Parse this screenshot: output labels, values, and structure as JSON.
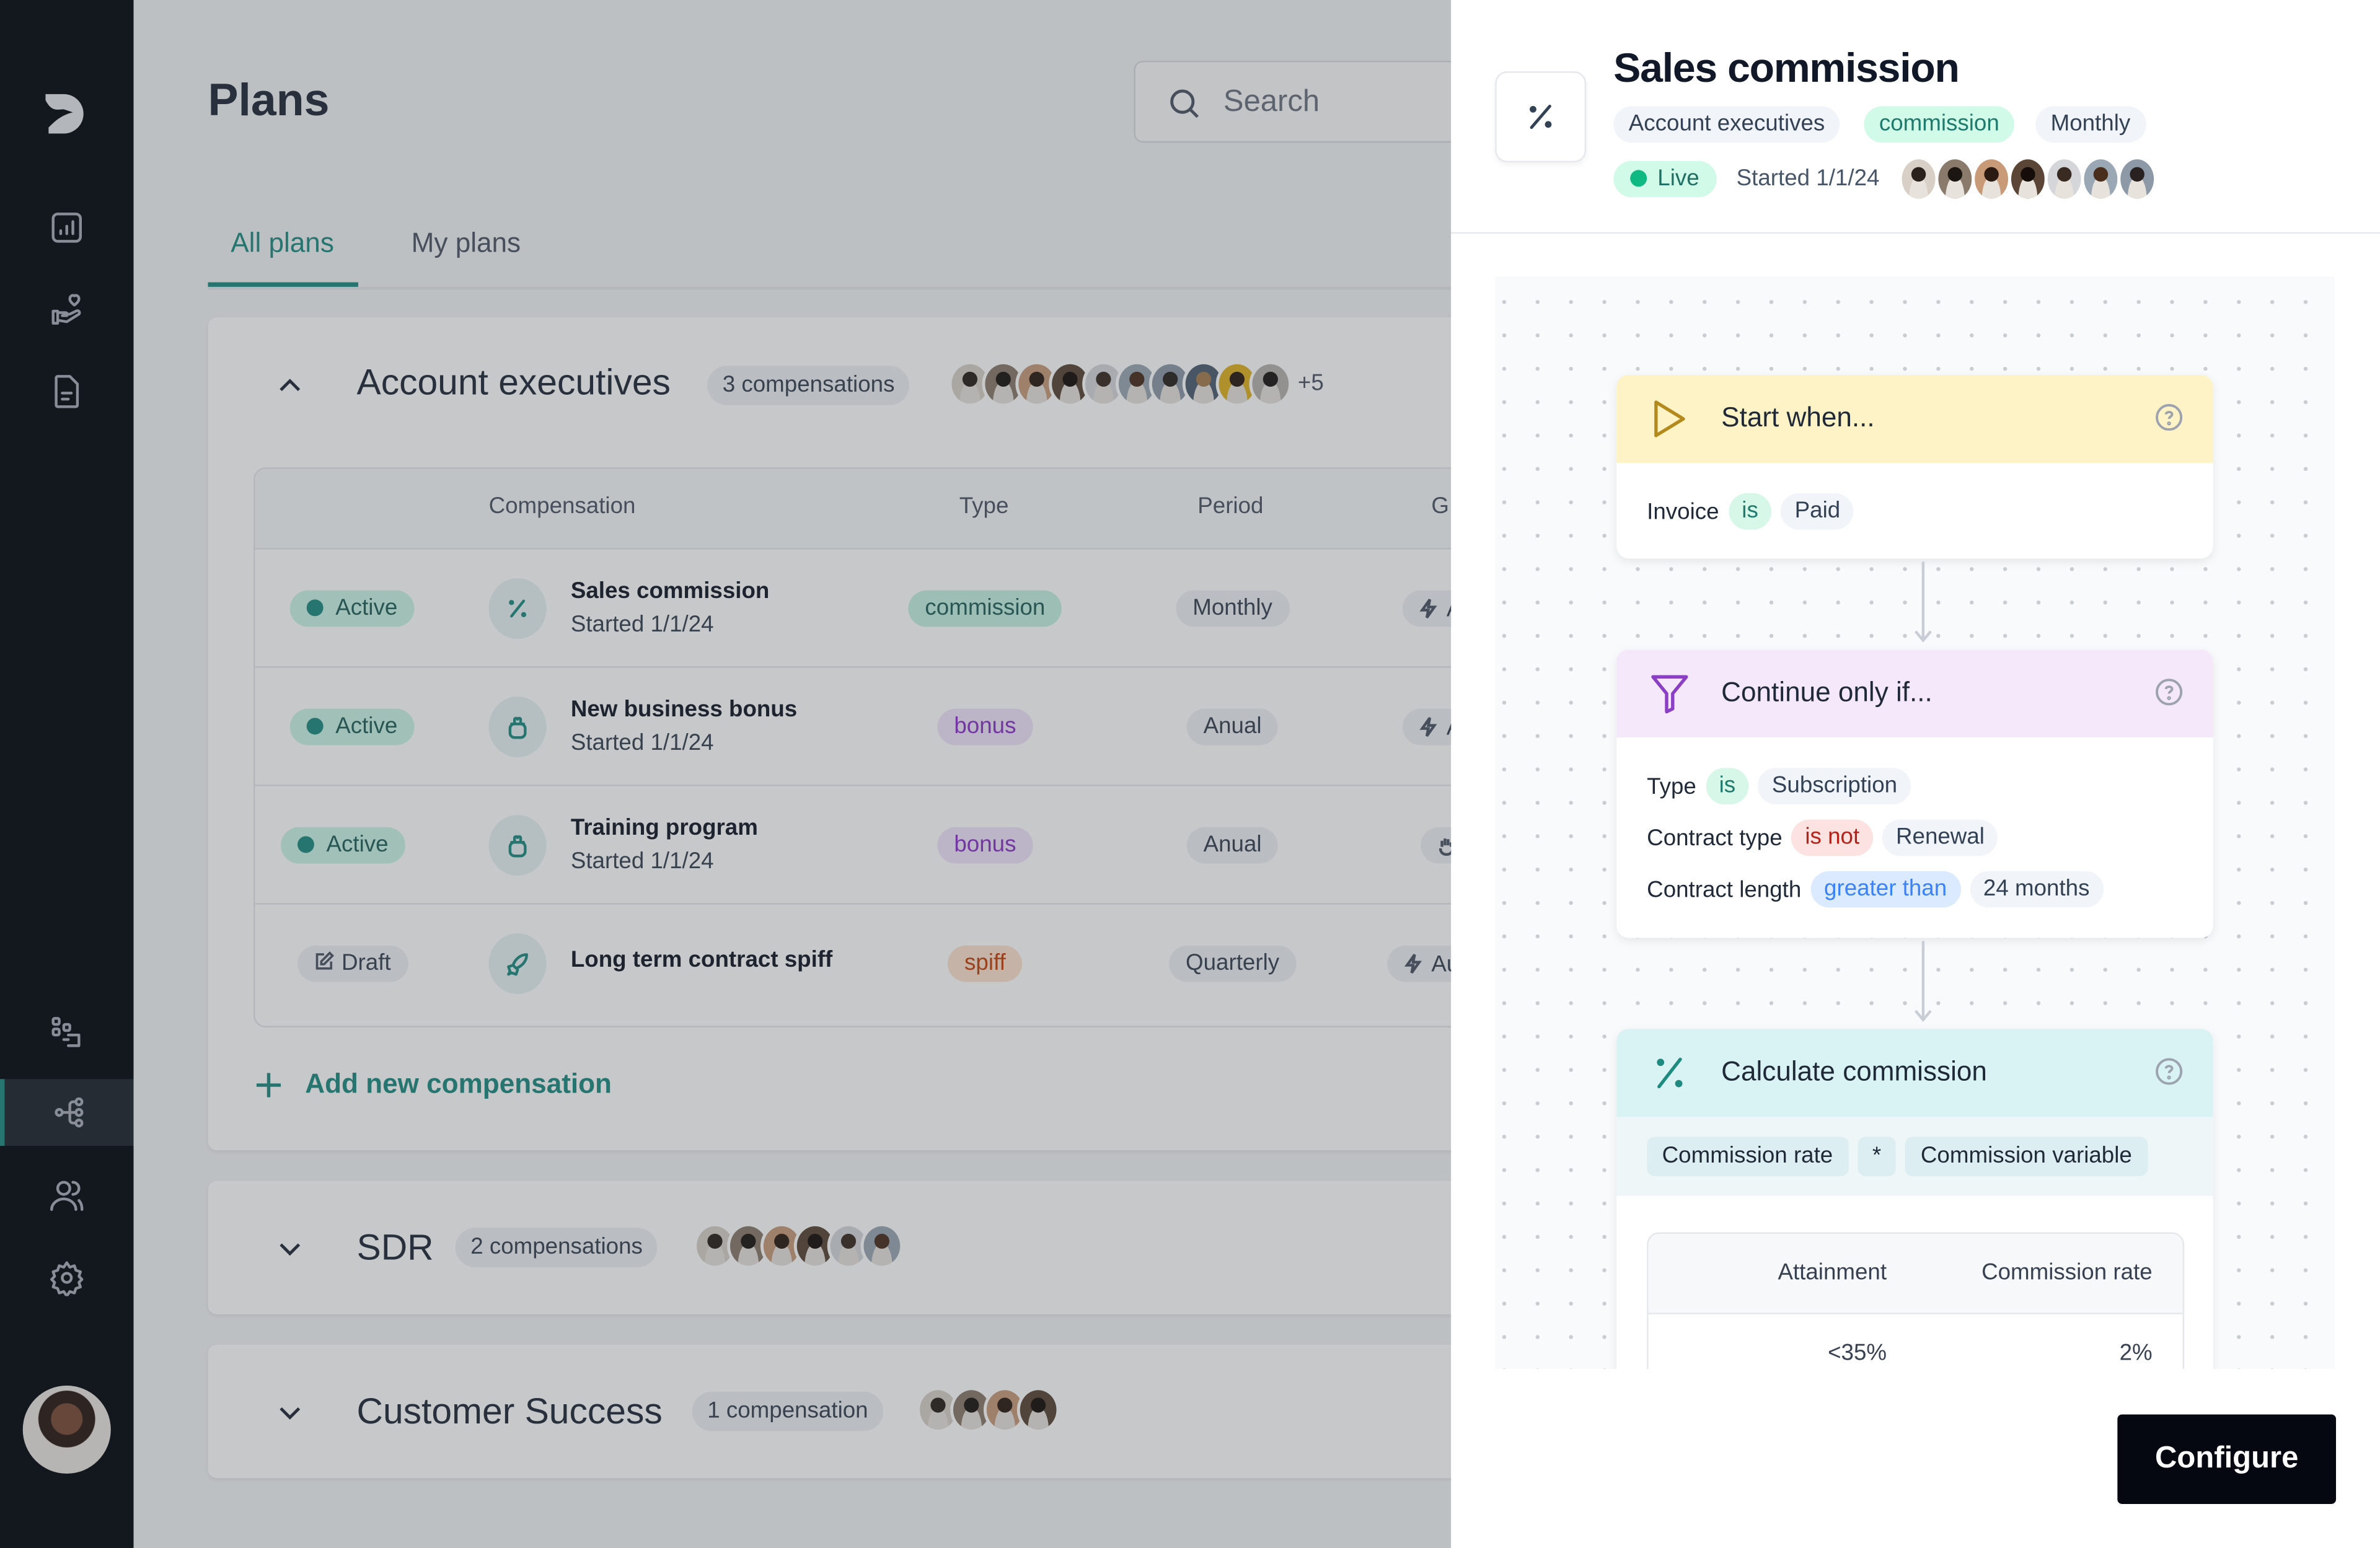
{
  "sidebar": {
    "items": [
      {
        "name": "dashboard",
        "icon": "bar-chart-icon"
      },
      {
        "name": "incentives",
        "icon": "hand-heart-icon"
      },
      {
        "name": "documents",
        "icon": "document-icon"
      },
      {
        "name": "hierarchy",
        "icon": "hierarchy-icon"
      },
      {
        "name": "plans",
        "icon": "flow-icon",
        "active": true
      },
      {
        "name": "people",
        "icon": "users-icon"
      },
      {
        "name": "settings",
        "icon": "gear-icon"
      }
    ]
  },
  "page": {
    "title": "Plans",
    "search_placeholder": "Search",
    "tabs": [
      {
        "label": "All plans",
        "active": true
      },
      {
        "label": "My plans",
        "active": false
      }
    ]
  },
  "groups": [
    {
      "title": "Account executives",
      "count": "3 compensations",
      "expanded": true,
      "avatar_count": 10,
      "more": "+5",
      "table": {
        "headers": [
          "Compensation",
          "Type",
          "Period",
          "G"
        ],
        "rows": [
          {
            "status": "Active",
            "icon": "percent-icon",
            "name": "Sales commission",
            "started": "Started 1/1/24",
            "type": "commission",
            "period": "Monthly",
            "gen_icon": "lightning-icon",
            "gen": "A"
          },
          {
            "status": "Active",
            "icon": "gift-jar-icon",
            "name": "New business bonus",
            "started": "Started 1/1/24",
            "type": "bonus",
            "period": "Anual",
            "gen_icon": "lightning-icon",
            "gen": "A"
          },
          {
            "status": "Active",
            "icon": "gift-jar-icon",
            "name": "Training program",
            "started": "Started 1/1/24",
            "type": "bonus",
            "period": "Anual",
            "gen_icon": "hand-icon",
            "gen": ""
          },
          {
            "status": "Draft",
            "icon": "rocket-icon",
            "name": "Long term contract spiff",
            "started": "",
            "type": "spiff",
            "period": "Quarterly",
            "gen_icon": "lightning-icon",
            "gen": "Au"
          }
        ]
      },
      "add_label": "Add new compensation"
    },
    {
      "title": "SDR",
      "count": "2 compensations",
      "expanded": false,
      "avatar_count": 6
    },
    {
      "title": "Customer Success",
      "count": "1 compensation",
      "expanded": false,
      "avatar_count": 4
    }
  ],
  "panel": {
    "title": "Sales commission",
    "tags": [
      "Account executives",
      "commission",
      "Monthly"
    ],
    "status": "Live",
    "started": "Started 1/1/24",
    "avatar_count": 7,
    "steps": [
      {
        "title": "Start when...",
        "icon": "play-icon",
        "conditions": [
          [
            "Invoice",
            "is",
            "Paid"
          ]
        ]
      },
      {
        "title": "Continue only if...",
        "icon": "filter-icon",
        "conditions": [
          [
            "Type",
            "is",
            "Subscription"
          ],
          [
            "Contract type",
            "is not",
            "Renewal"
          ],
          [
            "Contract length",
            "greater than",
            "24 months"
          ]
        ]
      },
      {
        "title": "Calculate commission",
        "icon": "percent-icon",
        "formula": [
          "Commission rate",
          "*",
          "Commission variable"
        ],
        "rate_table": {
          "headers": [
            "Attainment",
            "Commission rate"
          ],
          "rows": [
            [
              "<35%",
              "2%"
            ]
          ]
        }
      }
    ],
    "configure_label": "Configure"
  },
  "colors": {
    "accent": "#1f8a80",
    "sidebar_bg": "#03060e",
    "start_header": "#fef3c7",
    "filter_header": "#f5e8fb",
    "calc_header": "#d9f2f3",
    "cta": "#050810"
  }
}
